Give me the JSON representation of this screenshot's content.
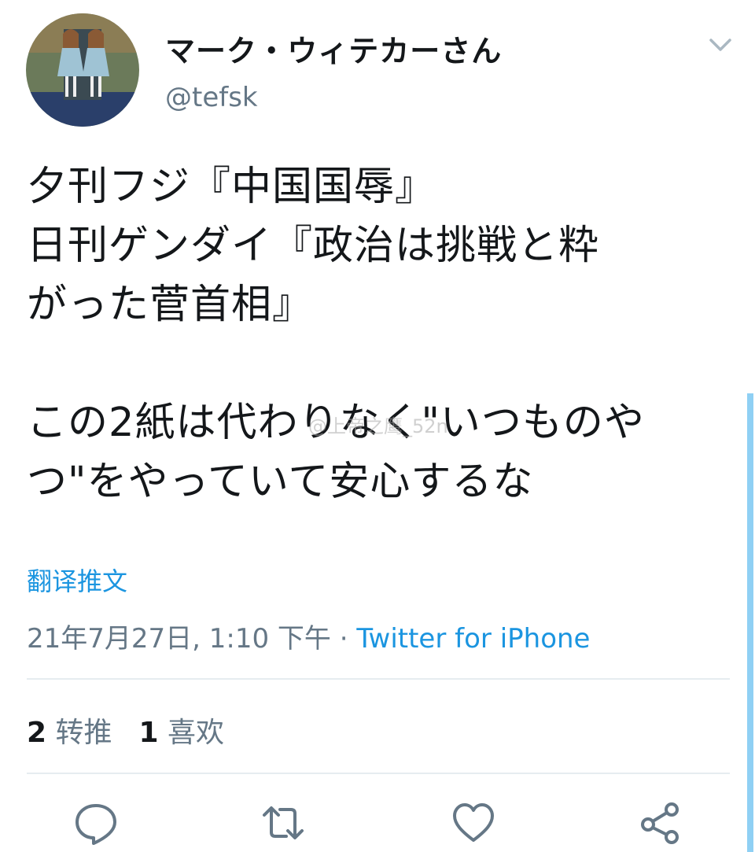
{
  "user": {
    "display_name": "マーク・ウィテカーさん",
    "handle": "@tefsk"
  },
  "tweet": {
    "text": "夕刊フジ『中国国辱』\n日刊ゲンダイ『政治は挑戦と粋\nがった菅首相』\n\nこの2紙は代わりなく\"いつものや\nつ\"をやっていて安心するな",
    "translate_label": "翻译推文",
    "timestamp": "21年7月27日, 1:10 下午",
    "separator": " · ",
    "source": "Twitter for iPhone"
  },
  "stats": {
    "retweets_count": "2",
    "retweets_label": "转推",
    "likes_count": "1",
    "likes_label": "喜欢"
  },
  "watermark": "@上帝之鹰_52n",
  "icons": {
    "menu": "chevron-down-icon",
    "reply": "reply-icon",
    "retweet": "retweet-icon",
    "like": "heart-icon",
    "share": "share-icon"
  },
  "colors": {
    "link": "#1b95e0",
    "secondary_text": "#657786",
    "icon": "#657786",
    "divider": "#e6ecf0"
  }
}
